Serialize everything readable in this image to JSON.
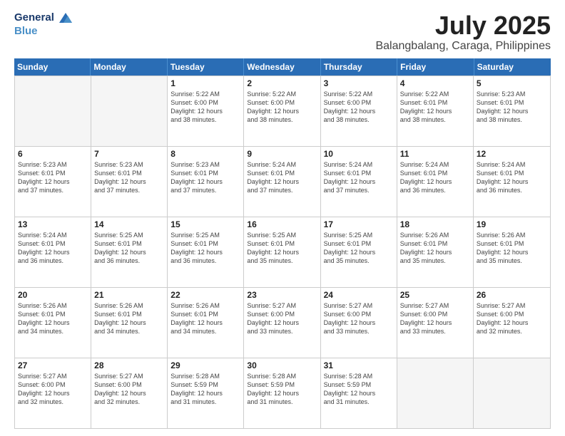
{
  "header": {
    "logo_line1": "General",
    "logo_line2": "Blue",
    "month": "July 2025",
    "location": "Balangbalang, Caraga, Philippines"
  },
  "weekdays": [
    "Sunday",
    "Monday",
    "Tuesday",
    "Wednesday",
    "Thursday",
    "Friday",
    "Saturday"
  ],
  "rows": [
    [
      {
        "day": "",
        "lines": [],
        "empty": true
      },
      {
        "day": "",
        "lines": [],
        "empty": true
      },
      {
        "day": "1",
        "lines": [
          "Sunrise: 5:22 AM",
          "Sunset: 6:00 PM",
          "Daylight: 12 hours",
          "and 38 minutes."
        ]
      },
      {
        "day": "2",
        "lines": [
          "Sunrise: 5:22 AM",
          "Sunset: 6:00 PM",
          "Daylight: 12 hours",
          "and 38 minutes."
        ]
      },
      {
        "day": "3",
        "lines": [
          "Sunrise: 5:22 AM",
          "Sunset: 6:00 PM",
          "Daylight: 12 hours",
          "and 38 minutes."
        ]
      },
      {
        "day": "4",
        "lines": [
          "Sunrise: 5:22 AM",
          "Sunset: 6:01 PM",
          "Daylight: 12 hours",
          "and 38 minutes."
        ]
      },
      {
        "day": "5",
        "lines": [
          "Sunrise: 5:23 AM",
          "Sunset: 6:01 PM",
          "Daylight: 12 hours",
          "and 38 minutes."
        ]
      }
    ],
    [
      {
        "day": "6",
        "lines": [
          "Sunrise: 5:23 AM",
          "Sunset: 6:01 PM",
          "Daylight: 12 hours",
          "and 37 minutes."
        ]
      },
      {
        "day": "7",
        "lines": [
          "Sunrise: 5:23 AM",
          "Sunset: 6:01 PM",
          "Daylight: 12 hours",
          "and 37 minutes."
        ]
      },
      {
        "day": "8",
        "lines": [
          "Sunrise: 5:23 AM",
          "Sunset: 6:01 PM",
          "Daylight: 12 hours",
          "and 37 minutes."
        ]
      },
      {
        "day": "9",
        "lines": [
          "Sunrise: 5:24 AM",
          "Sunset: 6:01 PM",
          "Daylight: 12 hours",
          "and 37 minutes."
        ]
      },
      {
        "day": "10",
        "lines": [
          "Sunrise: 5:24 AM",
          "Sunset: 6:01 PM",
          "Daylight: 12 hours",
          "and 37 minutes."
        ]
      },
      {
        "day": "11",
        "lines": [
          "Sunrise: 5:24 AM",
          "Sunset: 6:01 PM",
          "Daylight: 12 hours",
          "and 36 minutes."
        ]
      },
      {
        "day": "12",
        "lines": [
          "Sunrise: 5:24 AM",
          "Sunset: 6:01 PM",
          "Daylight: 12 hours",
          "and 36 minutes."
        ]
      }
    ],
    [
      {
        "day": "13",
        "lines": [
          "Sunrise: 5:24 AM",
          "Sunset: 6:01 PM",
          "Daylight: 12 hours",
          "and 36 minutes."
        ]
      },
      {
        "day": "14",
        "lines": [
          "Sunrise: 5:25 AM",
          "Sunset: 6:01 PM",
          "Daylight: 12 hours",
          "and 36 minutes."
        ]
      },
      {
        "day": "15",
        "lines": [
          "Sunrise: 5:25 AM",
          "Sunset: 6:01 PM",
          "Daylight: 12 hours",
          "and 36 minutes."
        ]
      },
      {
        "day": "16",
        "lines": [
          "Sunrise: 5:25 AM",
          "Sunset: 6:01 PM",
          "Daylight: 12 hours",
          "and 35 minutes."
        ]
      },
      {
        "day": "17",
        "lines": [
          "Sunrise: 5:25 AM",
          "Sunset: 6:01 PM",
          "Daylight: 12 hours",
          "and 35 minutes."
        ]
      },
      {
        "day": "18",
        "lines": [
          "Sunrise: 5:26 AM",
          "Sunset: 6:01 PM",
          "Daylight: 12 hours",
          "and 35 minutes."
        ]
      },
      {
        "day": "19",
        "lines": [
          "Sunrise: 5:26 AM",
          "Sunset: 6:01 PM",
          "Daylight: 12 hours",
          "and 35 minutes."
        ]
      }
    ],
    [
      {
        "day": "20",
        "lines": [
          "Sunrise: 5:26 AM",
          "Sunset: 6:01 PM",
          "Daylight: 12 hours",
          "and 34 minutes."
        ]
      },
      {
        "day": "21",
        "lines": [
          "Sunrise: 5:26 AM",
          "Sunset: 6:01 PM",
          "Daylight: 12 hours",
          "and 34 minutes."
        ]
      },
      {
        "day": "22",
        "lines": [
          "Sunrise: 5:26 AM",
          "Sunset: 6:01 PM",
          "Daylight: 12 hours",
          "and 34 minutes."
        ]
      },
      {
        "day": "23",
        "lines": [
          "Sunrise: 5:27 AM",
          "Sunset: 6:00 PM",
          "Daylight: 12 hours",
          "and 33 minutes."
        ]
      },
      {
        "day": "24",
        "lines": [
          "Sunrise: 5:27 AM",
          "Sunset: 6:00 PM",
          "Daylight: 12 hours",
          "and 33 minutes."
        ]
      },
      {
        "day": "25",
        "lines": [
          "Sunrise: 5:27 AM",
          "Sunset: 6:00 PM",
          "Daylight: 12 hours",
          "and 33 minutes."
        ]
      },
      {
        "day": "26",
        "lines": [
          "Sunrise: 5:27 AM",
          "Sunset: 6:00 PM",
          "Daylight: 12 hours",
          "and 32 minutes."
        ]
      }
    ],
    [
      {
        "day": "27",
        "lines": [
          "Sunrise: 5:27 AM",
          "Sunset: 6:00 PM",
          "Daylight: 12 hours",
          "and 32 minutes."
        ]
      },
      {
        "day": "28",
        "lines": [
          "Sunrise: 5:27 AM",
          "Sunset: 6:00 PM",
          "Daylight: 12 hours",
          "and 32 minutes."
        ]
      },
      {
        "day": "29",
        "lines": [
          "Sunrise: 5:28 AM",
          "Sunset: 5:59 PM",
          "Daylight: 12 hours",
          "and 31 minutes."
        ]
      },
      {
        "day": "30",
        "lines": [
          "Sunrise: 5:28 AM",
          "Sunset: 5:59 PM",
          "Daylight: 12 hours",
          "and 31 minutes."
        ]
      },
      {
        "day": "31",
        "lines": [
          "Sunrise: 5:28 AM",
          "Sunset: 5:59 PM",
          "Daylight: 12 hours",
          "and 31 minutes."
        ]
      },
      {
        "day": "",
        "lines": [],
        "empty": true
      },
      {
        "day": "",
        "lines": [],
        "empty": true
      }
    ]
  ]
}
